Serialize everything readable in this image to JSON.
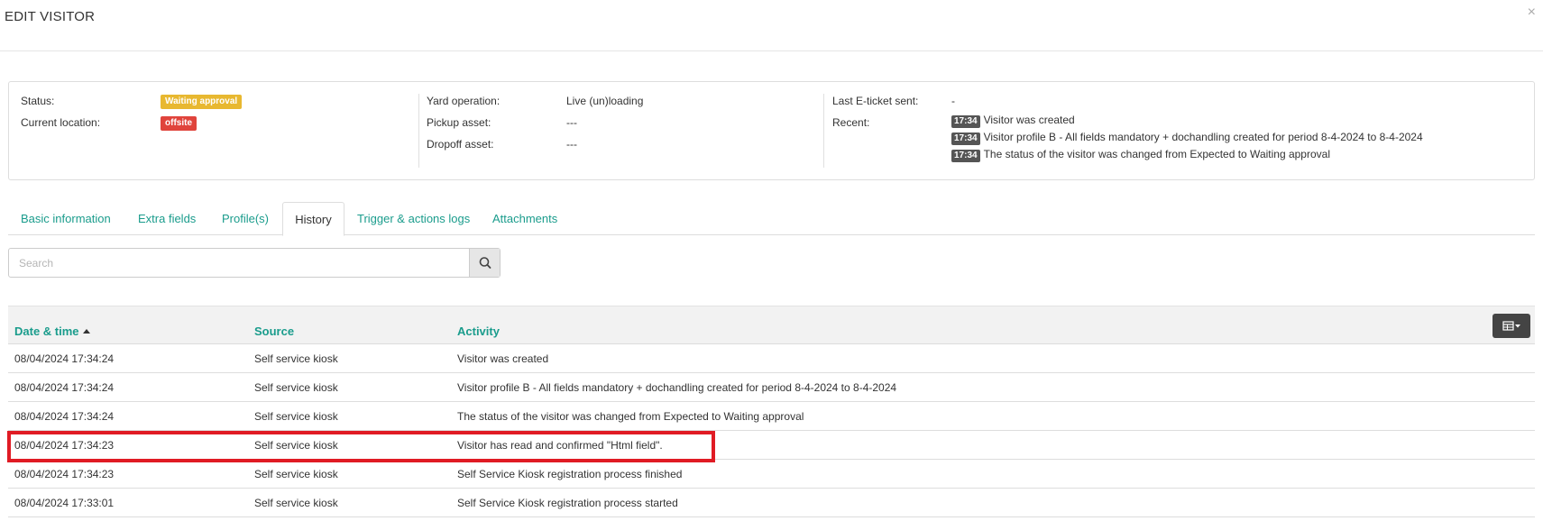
{
  "modal": {
    "title": "EDIT VISITOR",
    "close_symbol": "×"
  },
  "summary": {
    "col1": {
      "status_label": "Status:",
      "status_value": "Waiting approval",
      "location_label": "Current location:",
      "location_value": "offsite"
    },
    "col2": {
      "yard_label": "Yard operation:",
      "yard_value": "Live (un)loading",
      "pickup_label": "Pickup asset:",
      "pickup_value": "---",
      "dropoff_label": "Dropoff asset:",
      "dropoff_value": "---"
    },
    "col3": {
      "eticket_label": "Last E-ticket sent:",
      "eticket_value": "-",
      "recent_label": "Recent:",
      "recent": [
        {
          "time": "17:34",
          "text": "Visitor was created"
        },
        {
          "time": "17:34",
          "text": "Visitor profile B - All fields mandatory + dochandling created for period 8-4-2024 to 8-4-2024"
        },
        {
          "time": "17:34",
          "text": "The status of the visitor was changed from Expected to Waiting approval"
        }
      ]
    }
  },
  "tabs": [
    {
      "label": "Basic information"
    },
    {
      "label": "Extra fields"
    },
    {
      "label": "Profile(s)"
    },
    {
      "label": "History"
    },
    {
      "label": "Trigger & actions logs"
    },
    {
      "label": "Attachments"
    }
  ],
  "active_tab": "History",
  "search": {
    "placeholder": "Search",
    "value": ""
  },
  "table": {
    "headers": {
      "datetime": "Date & time",
      "source": "Source",
      "activity": "Activity"
    },
    "sort_column": "Date & time",
    "sort_direction": "ascending",
    "rows": [
      {
        "datetime": "08/04/2024 17:34:24",
        "source": "Self service kiosk",
        "activity": "Visitor was created"
      },
      {
        "datetime": "08/04/2024 17:34:24",
        "source": "Self service kiosk",
        "activity": "Visitor profile B - All fields mandatory + dochandling created for period 8-4-2024 to 8-4-2024"
      },
      {
        "datetime": "08/04/2024 17:34:24",
        "source": "Self service kiosk",
        "activity": "The status of the visitor was changed from Expected to Waiting approval"
      },
      {
        "datetime": "08/04/2024 17:34:23",
        "source": "Self service kiosk",
        "activity": "Visitor has read and confirmed \"Html field\"."
      },
      {
        "datetime": "08/04/2024 17:34:23",
        "source": "Self service kiosk",
        "activity": "Self Service Kiosk registration process finished"
      },
      {
        "datetime": "08/04/2024 17:33:01",
        "source": "Self service kiosk",
        "activity": "Self Service Kiosk registration process started"
      }
    ]
  },
  "colors": {
    "accent": "#1a9c8c",
    "status_badge": "#e8b830",
    "location_badge": "#e0443c",
    "highlight": "#e01b24"
  },
  "icons": {
    "search": "search-icon",
    "columns": "columns-toggle-icon",
    "close": "close-icon"
  }
}
